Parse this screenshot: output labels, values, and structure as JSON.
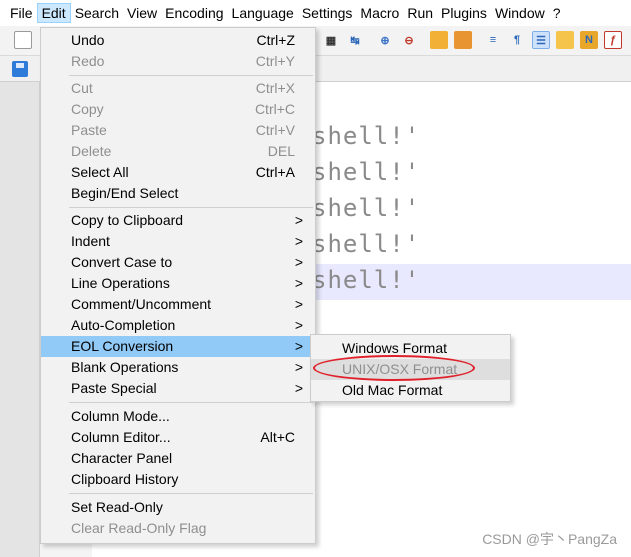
{
  "menubar": {
    "items": [
      "File",
      "Edit",
      "Search",
      "View",
      "Encoding",
      "Language",
      "Settings",
      "Macro",
      "Run",
      "Plugins",
      "Window",
      "?"
    ]
  },
  "editor": {
    "lines": [
      "shell!'",
      "shell!'",
      "shell!'",
      "shell!'",
      "shell!'"
    ]
  },
  "edit_menu": {
    "undo": {
      "label": "Undo",
      "shortcut": "Ctrl+Z"
    },
    "redo": {
      "label": "Redo",
      "shortcut": "Ctrl+Y"
    },
    "cut": {
      "label": "Cut",
      "shortcut": "Ctrl+X"
    },
    "copy": {
      "label": "Copy",
      "shortcut": "Ctrl+C"
    },
    "paste": {
      "label": "Paste",
      "shortcut": "Ctrl+V"
    },
    "delete": {
      "label": "Delete",
      "shortcut": "DEL"
    },
    "select_all": {
      "label": "Select All",
      "shortcut": "Ctrl+A"
    },
    "begin_end_select": {
      "label": "Begin/End Select"
    },
    "copy_to_clipboard": {
      "label": "Copy to Clipboard",
      "arrow": ">"
    },
    "indent": {
      "label": "Indent",
      "arrow": ">"
    },
    "convert_case": {
      "label": "Convert Case to",
      "arrow": ">"
    },
    "line_operations": {
      "label": "Line Operations",
      "arrow": ">"
    },
    "comment": {
      "label": "Comment/Uncomment",
      "arrow": ">"
    },
    "auto_completion": {
      "label": "Auto-Completion",
      "arrow": ">"
    },
    "eol_conversion": {
      "label": "EOL Conversion",
      "arrow": ">"
    },
    "blank_operations": {
      "label": "Blank Operations",
      "arrow": ">"
    },
    "paste_special": {
      "label": "Paste Special",
      "arrow": ">"
    },
    "column_mode": {
      "label": "Column Mode..."
    },
    "column_editor": {
      "label": "Column Editor...",
      "shortcut": "Alt+C"
    },
    "character_panel": {
      "label": "Character Panel"
    },
    "clipboard_history": {
      "label": "Clipboard History"
    },
    "set_read_only": {
      "label": "Set Read-Only"
    },
    "clear_read_only": {
      "label": "Clear Read-Only Flag"
    }
  },
  "eol_submenu": {
    "windows": "Windows Format",
    "unix": "UNIX/OSX Format",
    "mac": "Old Mac Format"
  },
  "watermark": "CSDN @宇丶PangZa",
  "colors": {
    "menu_highlight": "#91c9f7",
    "annotation_ellipse": "#e0202a",
    "current_line": "#e8e8ff"
  }
}
